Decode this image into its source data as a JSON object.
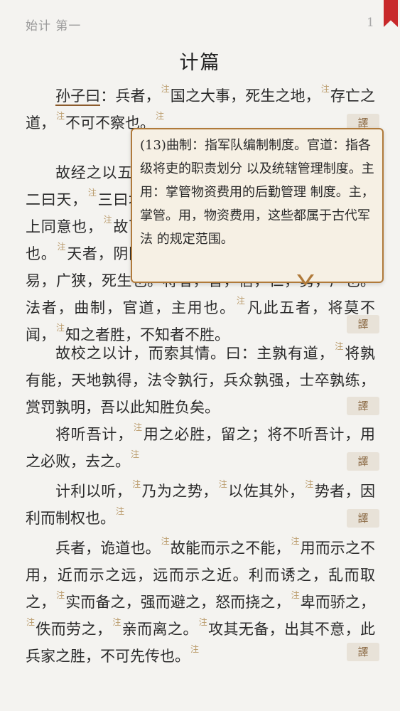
{
  "header": {
    "chapter": "始计 第一",
    "page_number": "1"
  },
  "title": "计篇",
  "note_marker": "注",
  "translate_label": "譯",
  "popup": {
    "text": "(13)曲制：指军队编制制度。官道：指各级将吏的职责划分 以及统辖管理制度。主用：掌管物资费用的后勤管理 制度。主，掌管。用，物资费用，这些都属于古代军法 的规定范围。"
  },
  "paragraphs": [
    {
      "segments": [
        {
          "t": "孙子曰",
          "u": true
        },
        {
          "t": "：兵者，",
          "n": true
        },
        {
          "t": "国之大事，死生之地，",
          "n": true
        },
        {
          "t": "存亡之道，",
          "n": true
        },
        {
          "t": "不可不察也。",
          "n": true
        }
      ]
    },
    {
      "segments": [
        {
          "t": "故经之以五事，校之以计而索其情：一曰道，",
          "n": true
        },
        {
          "t": "二曰天，",
          "n": true
        },
        {
          "t": "三曰地，四曰将，五曰法。道者，令民与上同意也，",
          "n": true
        },
        {
          "t": "故可以与之死，可以与之生，而不畏危也。",
          "n": true
        },
        {
          "t": "天者，阴阳、寒暑、时制也。地者，远近，险易，广狭，死生也。将者，智，信，仁，勇，严也。法者，曲制，官道，主用也。",
          "n": true
        },
        {
          "t": "凡此五者，将莫不闻，",
          "n": true
        },
        {
          "t": "知之者胜，不知者不胜。"
        }
      ]
    },
    {
      "segments": [
        {
          "t": "故校之以计，而索其情。曰：主孰有道，",
          "n": true
        },
        {
          "t": "将孰有能，天地孰得，法令孰行，兵众孰强，士卒孰练，赏罚孰明，吾以此知胜负矣。"
        }
      ]
    },
    {
      "segments": [
        {
          "t": "将听吾计，",
          "n": true
        },
        {
          "t": "用之必胜，留之；将不听吾计，用之必败，去之。",
          "n": true
        }
      ]
    },
    {
      "segments": [
        {
          "t": "计利以听，",
          "n": true
        },
        {
          "t": "乃为之势，",
          "n": true
        },
        {
          "t": "以佐其外，",
          "n": true
        },
        {
          "t": "势者，因利而制权也。",
          "n": true
        }
      ]
    },
    {
      "segments": [
        {
          "t": "兵者，诡道也。",
          "n": true
        },
        {
          "t": "故能而示之不能，",
          "n": true
        },
        {
          "t": "用而示之不用，近而示之远，远而示之近。利而诱之，乱而取之，",
          "n": true
        },
        {
          "t": "实而备之，强而避之，怒而挠之，",
          "n": true
        },
        {
          "t": "卑而骄之，",
          "n": true
        },
        {
          "t": "佚而劳之，",
          "n": true
        },
        {
          "t": "亲而离之。",
          "n": true
        },
        {
          "t": "攻其无备，出其不意，此兵家之胜，不可先传也。",
          "n": true
        }
      ]
    }
  ]
}
